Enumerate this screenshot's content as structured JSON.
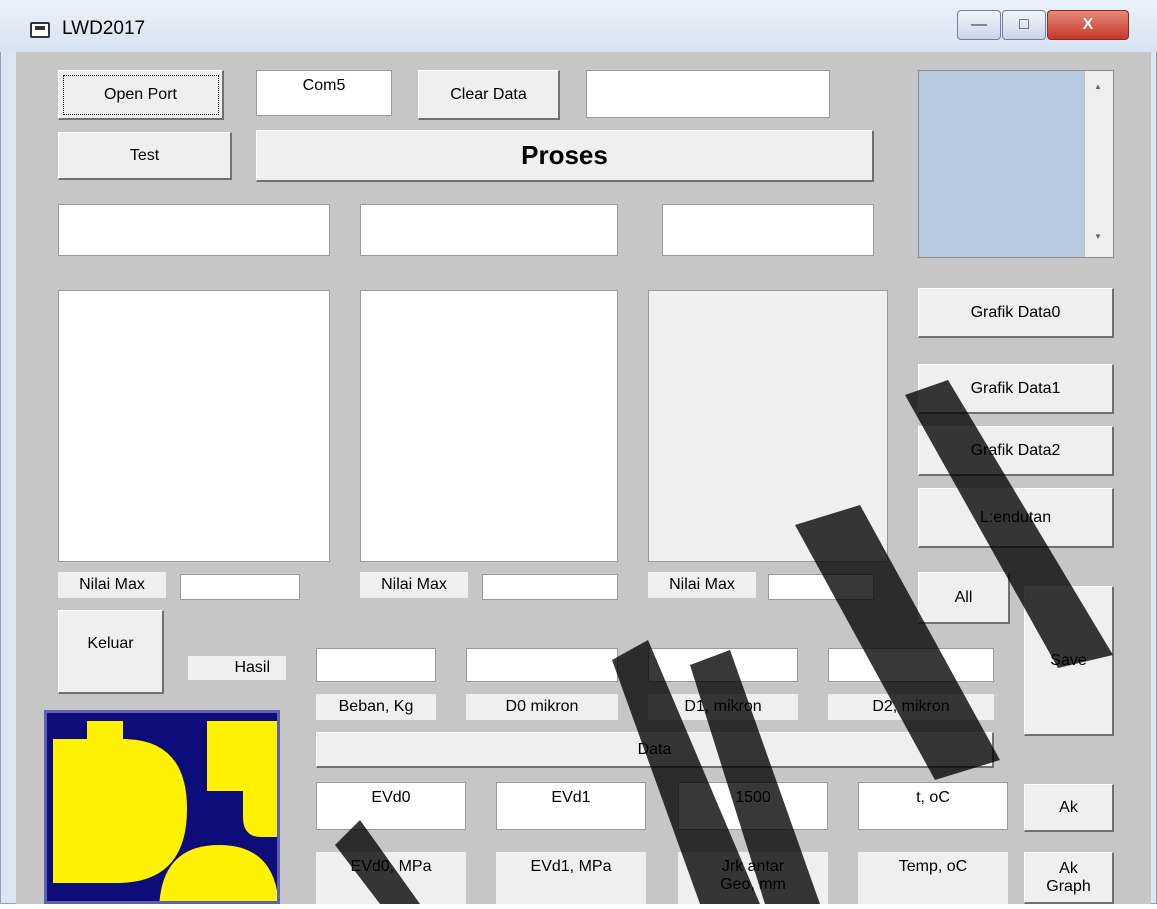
{
  "window": {
    "title": "LWD2017"
  },
  "titlebar": {
    "min_glyph": "—",
    "max_glyph": "□",
    "close_glyph": "X"
  },
  "top": {
    "open_port": "Open Port",
    "com_value": "Com5",
    "clear_data": "Clear Data",
    "test": "Test",
    "proses": "Proses"
  },
  "listbox": {
    "scroll_up": "▲",
    "scroll_down": "▼"
  },
  "graph_buttons": [
    "Grafik Data0",
    "Grafik Data1",
    "Grafik Data2",
    "L:endutan",
    "All"
  ],
  "nilai_max_label": "Nilai Max",
  "actions": {
    "save": "Save",
    "keluar": "Keluar",
    "ak": "Ak",
    "ak_graph": "Ak Graph"
  },
  "results": {
    "hasil_label": "Hasil",
    "captions": [
      "Beban, Kg",
      "D0 mikron",
      "D1, mikron",
      "D2, mikron"
    ],
    "data_label": "Data",
    "ev_values": [
      "EVd0",
      "EVd1",
      "1500",
      "t, oC"
    ],
    "ev_captions": [
      "EVd0, MPa",
      "EVd1, MPa",
      "Jrk antar Geo, mm",
      "Temp, oC"
    ]
  },
  "colors": {
    "logo_blue": "#0c0c7a",
    "logo_yellow": "#fff200",
    "form_bg": "#c6c6c6"
  }
}
